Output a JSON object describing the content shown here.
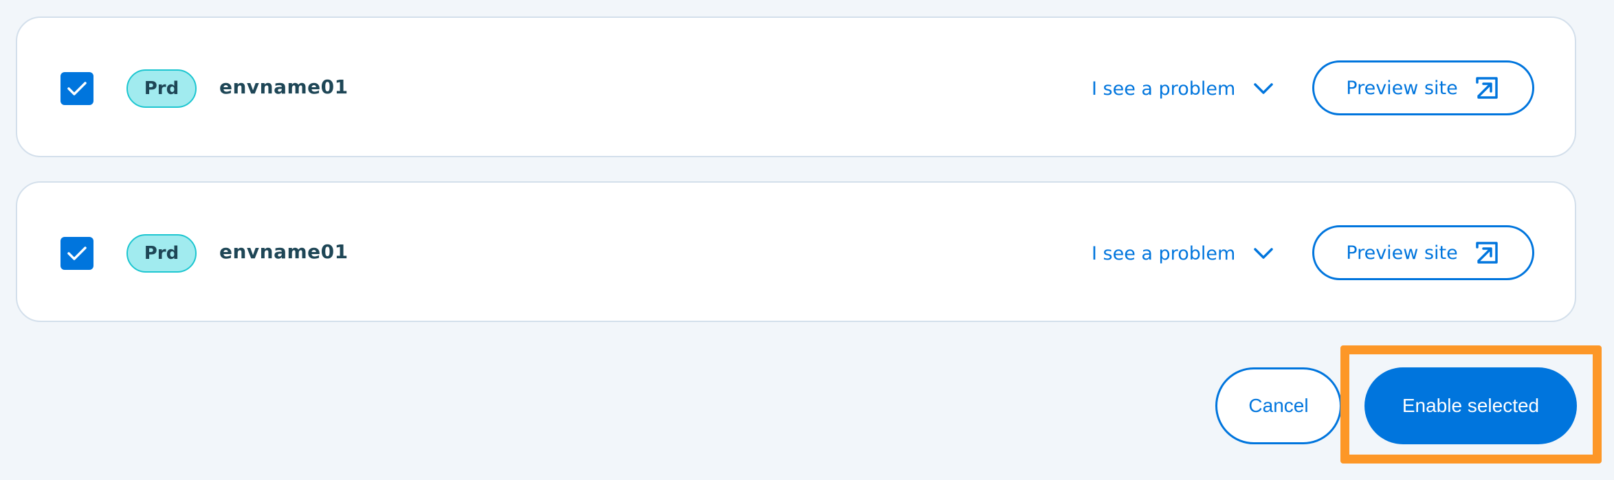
{
  "colors": {
    "primary": "#0075dd",
    "badge_bg": "#a1ebef",
    "badge_border": "#1cc6d0",
    "text_dark": "#1e4656",
    "highlight": "#fd9727",
    "page_bg": "#f2f6fa"
  },
  "environments": [
    {
      "checked": true,
      "badge": "Prd",
      "name": "envname01",
      "problem_label": "I see a problem",
      "problem_icon": "chevron-down-icon",
      "preview_label": "Preview site",
      "preview_icon": "external-link-icon"
    },
    {
      "checked": true,
      "badge": "Prd",
      "name": "envname01",
      "problem_label": "I see a problem",
      "problem_icon": "chevron-down-icon",
      "preview_label": "Preview site",
      "preview_icon": "external-link-icon"
    }
  ],
  "actions": {
    "cancel_label": "Cancel",
    "enable_label": "Enable selected"
  }
}
